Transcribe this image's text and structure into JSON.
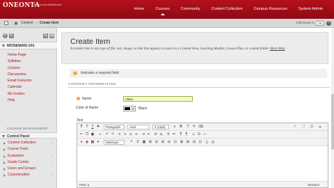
{
  "header": {
    "logo": "ONEONTA",
    "logo_sub": "Powered by Blackboard",
    "nav": [
      "Home",
      "Courses",
      "Community",
      "Content Collection",
      "Campus Resources",
      "System Admin"
    ],
    "active_nav": "Courses"
  },
  "breadcrumb": {
    "items": [
      "Content",
      "Create Item"
    ],
    "edit_mode_label": "Edit Mode is:",
    "edit_mode_value": "ON",
    "help": "?"
  },
  "sidebar": {
    "course_name": "MOSEMAN-101",
    "menu": [
      "Home Page",
      "Syllabus",
      "Content",
      "Discussions",
      "Email Instructor",
      "Calendar",
      "My Grades",
      "Help"
    ],
    "section_title": "COURSE MANAGEMENT",
    "control_panel_title": "Control Panel",
    "control_panel_items": [
      "Content Collection",
      "Course Tools",
      "Evaluation",
      "Grade Center",
      "Users and Groups",
      "Customization"
    ]
  },
  "main": {
    "title": "Create Item",
    "description": "A content item is any type of file, text, image, or link that appears to users in a Content Area, Learning Module, Lesson Plan, or content folder.",
    "more_help": "More Help",
    "required_note": "Indicates a required field.",
    "section_heading": "CONTENT INFORMATION",
    "name_label": "Name",
    "name_value": "Video",
    "color_label": "Color of Name",
    "color_value": "Black",
    "text_label": "Text"
  },
  "editor": {
    "paragraph": "Paragraph",
    "font": "Arial",
    "size": "3 (12pt)",
    "mashups": "Mashups",
    "path": "Path: p",
    "words": "Words:0"
  },
  "colors": {
    "brand": "#b3111c",
    "required": "#f2a33a",
    "name_input_bg": "#f7f9c8"
  }
}
